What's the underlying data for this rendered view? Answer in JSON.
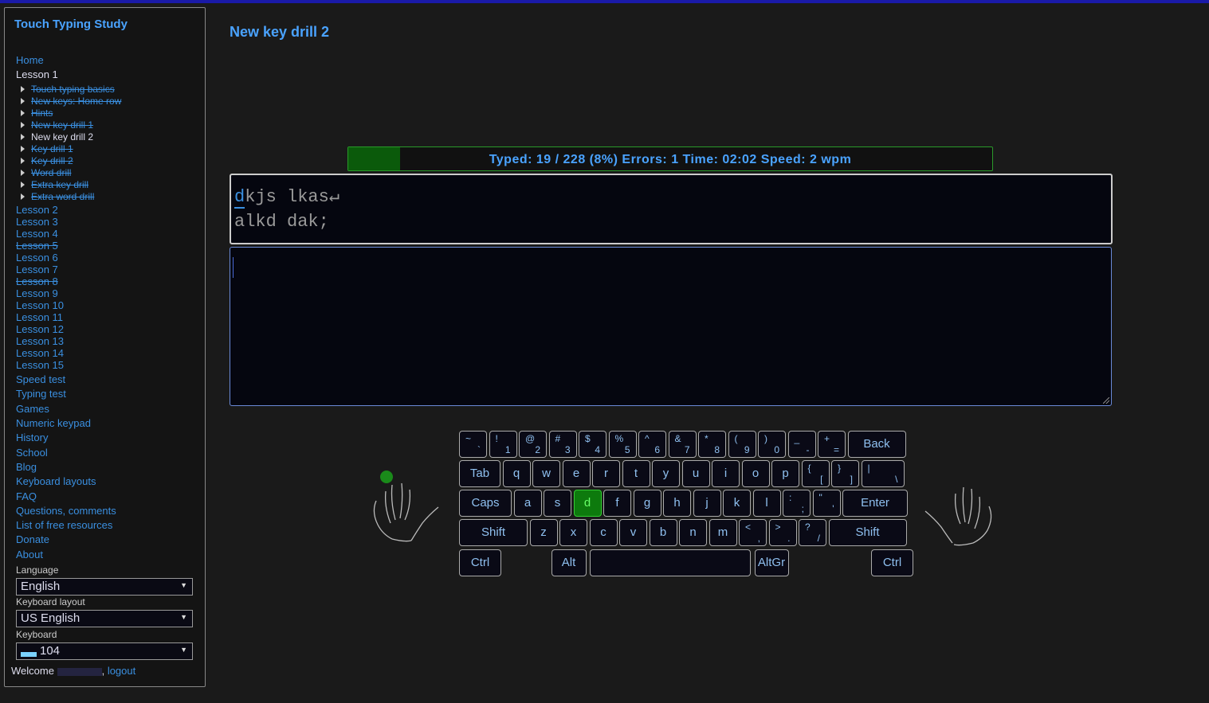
{
  "sidebar": {
    "title": "Touch Typing Study",
    "nav": [
      {
        "label": "Home"
      },
      {
        "label": "Lesson 1"
      }
    ],
    "lesson1_items": [
      {
        "label": "Touch typing basics",
        "done": true
      },
      {
        "label": "New keys: Home row",
        "done": true
      },
      {
        "label": "Hints",
        "done": true
      },
      {
        "label": "New key drill 1",
        "done": true
      },
      {
        "label": "New key drill 2",
        "done": false,
        "current": true
      },
      {
        "label": "Key drill 1",
        "done": true
      },
      {
        "label": "Key drill 2",
        "done": true
      },
      {
        "label": "Word drill",
        "done": true
      },
      {
        "label": "Extra key drill",
        "done": true
      },
      {
        "label": "Extra word drill",
        "done": true
      }
    ],
    "lessons": [
      {
        "label": "Lesson 2",
        "done": false
      },
      {
        "label": "Lesson 3",
        "done": false
      },
      {
        "label": "Lesson 4",
        "done": false
      },
      {
        "label": "Lesson 5",
        "done": true
      },
      {
        "label": "Lesson 6",
        "done": false
      },
      {
        "label": "Lesson 7",
        "done": false
      },
      {
        "label": "Lesson 8",
        "done": true
      },
      {
        "label": "Lesson 9",
        "done": false
      },
      {
        "label": "Lesson 10",
        "done": false
      },
      {
        "label": "Lesson 11",
        "done": false
      },
      {
        "label": "Lesson 12",
        "done": false
      },
      {
        "label": "Lesson 13",
        "done": false
      },
      {
        "label": "Lesson 14",
        "done": false
      },
      {
        "label": "Lesson 15",
        "done": false
      }
    ],
    "links": [
      {
        "label": "Speed test"
      },
      {
        "label": "Typing test"
      },
      {
        "label": "Games"
      },
      {
        "label": "Numeric keypad"
      },
      {
        "label": "History"
      },
      {
        "label": "School"
      },
      {
        "label": "Blog"
      },
      {
        "label": "Keyboard layouts"
      },
      {
        "label": "FAQ"
      },
      {
        "label": "Questions, comments"
      },
      {
        "label": "List of free resources"
      },
      {
        "label": "Donate"
      },
      {
        "label": "About"
      }
    ],
    "language_label": "Language",
    "language_value": "English",
    "layout_label": "Keyboard layout",
    "layout_value": "US English",
    "keyboard_label": "Keyboard",
    "keyboard_value": "104",
    "welcome_text": "Welcome",
    "logout_label": "logout"
  },
  "main": {
    "title": "New key drill 2",
    "progress": {
      "text": "Typed: 19 / 228 (8%) Errors: 1 Time: 02:02 Speed: 2 wpm",
      "fraction": 0.08
    },
    "text_current_char": "d",
    "text_line1_rest": "kjs lkas↵",
    "text_line2": "alkd dak;",
    "input_value": ""
  },
  "keyboard": {
    "highlight_key": "d",
    "rows": [
      [
        {
          "u": "~",
          "l": "`"
        },
        {
          "u": "!",
          "l": "1"
        },
        {
          "u": "@",
          "l": "2"
        },
        {
          "u": "#",
          "l": "3"
        },
        {
          "u": "$",
          "l": "4"
        },
        {
          "u": "%",
          "l": "5"
        },
        {
          "u": "^",
          "l": "6"
        },
        {
          "u": "&",
          "l": "7"
        },
        {
          "u": "*",
          "l": "8"
        },
        {
          "u": "(",
          "l": "9"
        },
        {
          "u": ")",
          "l": "0"
        },
        {
          "u": "_",
          "l": "-"
        },
        {
          "u": "+",
          "l": "="
        },
        {
          "c": "Back"
        }
      ],
      [
        {
          "c": "Tab"
        },
        {
          "c": "q"
        },
        {
          "c": "w"
        },
        {
          "c": "e"
        },
        {
          "c": "r"
        },
        {
          "c": "t"
        },
        {
          "c": "y"
        },
        {
          "c": "u"
        },
        {
          "c": "i"
        },
        {
          "c": "o"
        },
        {
          "c": "p"
        },
        {
          "u": "{",
          "l": "["
        },
        {
          "u": "}",
          "l": "]"
        },
        {
          "u": "|",
          "l": "\\"
        }
      ],
      [
        {
          "c": "Caps"
        },
        {
          "c": "a"
        },
        {
          "c": "s"
        },
        {
          "c": "d"
        },
        {
          "c": "f"
        },
        {
          "c": "g"
        },
        {
          "c": "h"
        },
        {
          "c": "j"
        },
        {
          "c": "k"
        },
        {
          "c": "l"
        },
        {
          "u": ":",
          "l": ";"
        },
        {
          "u": "\"",
          "l": "'"
        },
        {
          "c": "Enter"
        }
      ],
      [
        {
          "c": "Shift"
        },
        {
          "c": "z"
        },
        {
          "c": "x"
        },
        {
          "c": "c"
        },
        {
          "c": "v"
        },
        {
          "c": "b"
        },
        {
          "c": "n"
        },
        {
          "c": "m"
        },
        {
          "u": "<",
          "l": ","
        },
        {
          "u": ">",
          "l": "."
        },
        {
          "u": "?",
          "l": "/"
        },
        {
          "c": "Shift"
        }
      ],
      [
        {
          "c": "Ctrl"
        },
        {
          "c": "Alt"
        },
        {
          "c": ""
        },
        {
          "c": "AltGr"
        },
        {
          "c": "Ctrl"
        }
      ]
    ]
  },
  "colors": {
    "accent": "#4aa3ff",
    "link": "#3a8fe0",
    "highlight_key": "#0d7a0d",
    "progress_fill": "#0b5a0b",
    "finger_dot": "#1a8a1a"
  }
}
